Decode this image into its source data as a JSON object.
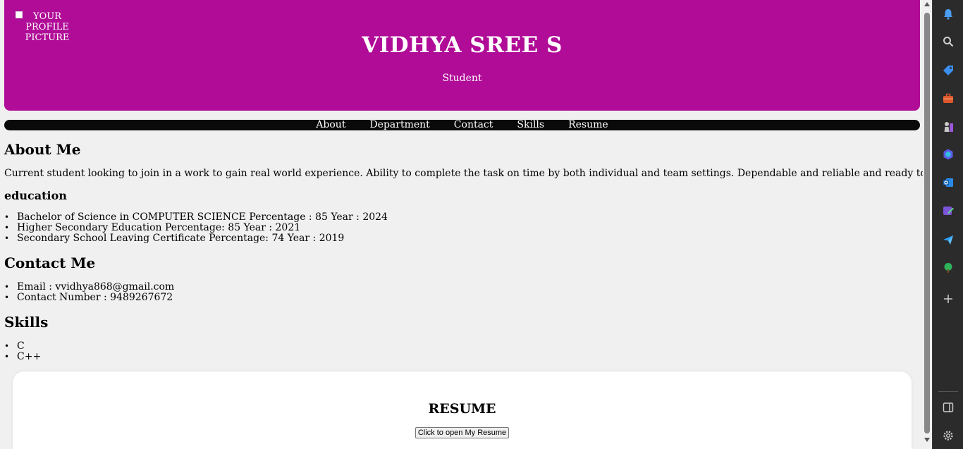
{
  "header": {
    "profile_alt": "YOUR PROFILE PICTURE",
    "name": "VIDHYA SREE S",
    "role": "Student"
  },
  "nav": {
    "items": [
      "About",
      "Department",
      "Contact",
      "Skills",
      "Resume"
    ]
  },
  "about": {
    "title": "About Me",
    "text": "Current student looking to join in a work to gain real world experience. Ability to complete the task on time by both individual and team settings. Dependable and reliable and ready to grow with the company."
  },
  "education": {
    "title": "education",
    "items": [
      "Bachelor of Science in COMPUTER SCIENCE Percentage : 85 Year : 2024",
      "Higher Secondary Education Percentage: 85 Year : 2021",
      "Secondary School Leaving Certificate Percentage: 74 Year : 2019"
    ]
  },
  "contact": {
    "title": "Contact Me",
    "items": [
      "Email : vvidhya868@gmail.com",
      "Contact Number : 9489267672"
    ]
  },
  "skills": {
    "title": "Skills",
    "items": [
      "C",
      "C++"
    ]
  },
  "resume": {
    "title": "RESUME",
    "button_label": "Click to open My Resume"
  },
  "colors": {
    "header_bg": "#b00c97",
    "nav_bg": "#0a0a0a",
    "page_bg": "#f0f0f0",
    "sidebar_bg": "#2b2b2b"
  },
  "sidebar": {
    "icons": [
      "bell-icon",
      "search-icon",
      "tag-icon",
      "briefcase-icon",
      "chess-icon",
      "copilot-icon",
      "outlook-icon",
      "designer-icon",
      "send-icon",
      "tree-icon",
      "add-icon",
      "split-screen-icon",
      "settings-icon"
    ]
  }
}
